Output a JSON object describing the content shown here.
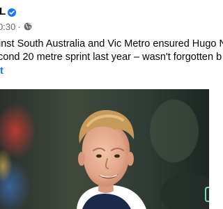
{
  "post": {
    "page_name": "L",
    "time": "0:30",
    "dot": "·",
    "text_lines": [
      "inst South Australia and Vic Metro ensured Hugo N",
      "cond 20 metre sprint last year – wasn't forgotten b"
    ],
    "see_more": "t"
  },
  "icons": {
    "verified": "verified-badge-icon",
    "audience": "globe-icon",
    "corner": "corner-bracket-icon"
  },
  "colors": {
    "verified_blue": "#1877f2",
    "link_blue": "#1877f2",
    "meta_gray": "#65676b",
    "text": "#050505"
  }
}
